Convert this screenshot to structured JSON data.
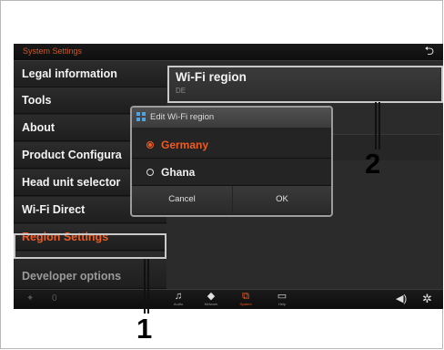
{
  "header": {
    "title": "System Settings",
    "back_icon": "back-arrow-icon"
  },
  "sidebar": {
    "items": [
      {
        "label": "Legal information"
      },
      {
        "label": "Tools"
      },
      {
        "label": "About"
      },
      {
        "label": "Product Configura"
      },
      {
        "label": "Head unit selector"
      },
      {
        "label": "Wi-Fi Direct"
      },
      {
        "label": "Region Settings"
      },
      {
        "label": "Developer options"
      }
    ]
  },
  "content": {
    "wifi_region_label": "Wi-Fi region",
    "wifi_region_value": "DE"
  },
  "dialog": {
    "title": "Edit Wi-Fi region",
    "options": [
      {
        "label": "Germany",
        "selected": true
      },
      {
        "label": "Ghana",
        "selected": false
      }
    ],
    "cancel_label": "Cancel",
    "ok_label": "OK"
  },
  "bottombar": {
    "items": [
      {
        "icon": "music-note-icon",
        "label": "Audio"
      },
      {
        "icon": "network-icon",
        "label": "Network"
      },
      {
        "icon": "system-icon",
        "label": "System",
        "active": true
      },
      {
        "icon": "help-icon",
        "label": "Help"
      }
    ],
    "volume_icon": "speaker-icon",
    "settings_icon": "gear-icon"
  },
  "callouts": {
    "one": "1",
    "two": "2"
  },
  "colors": {
    "accent": "#f05a23",
    "background": "#2a2a2a"
  }
}
